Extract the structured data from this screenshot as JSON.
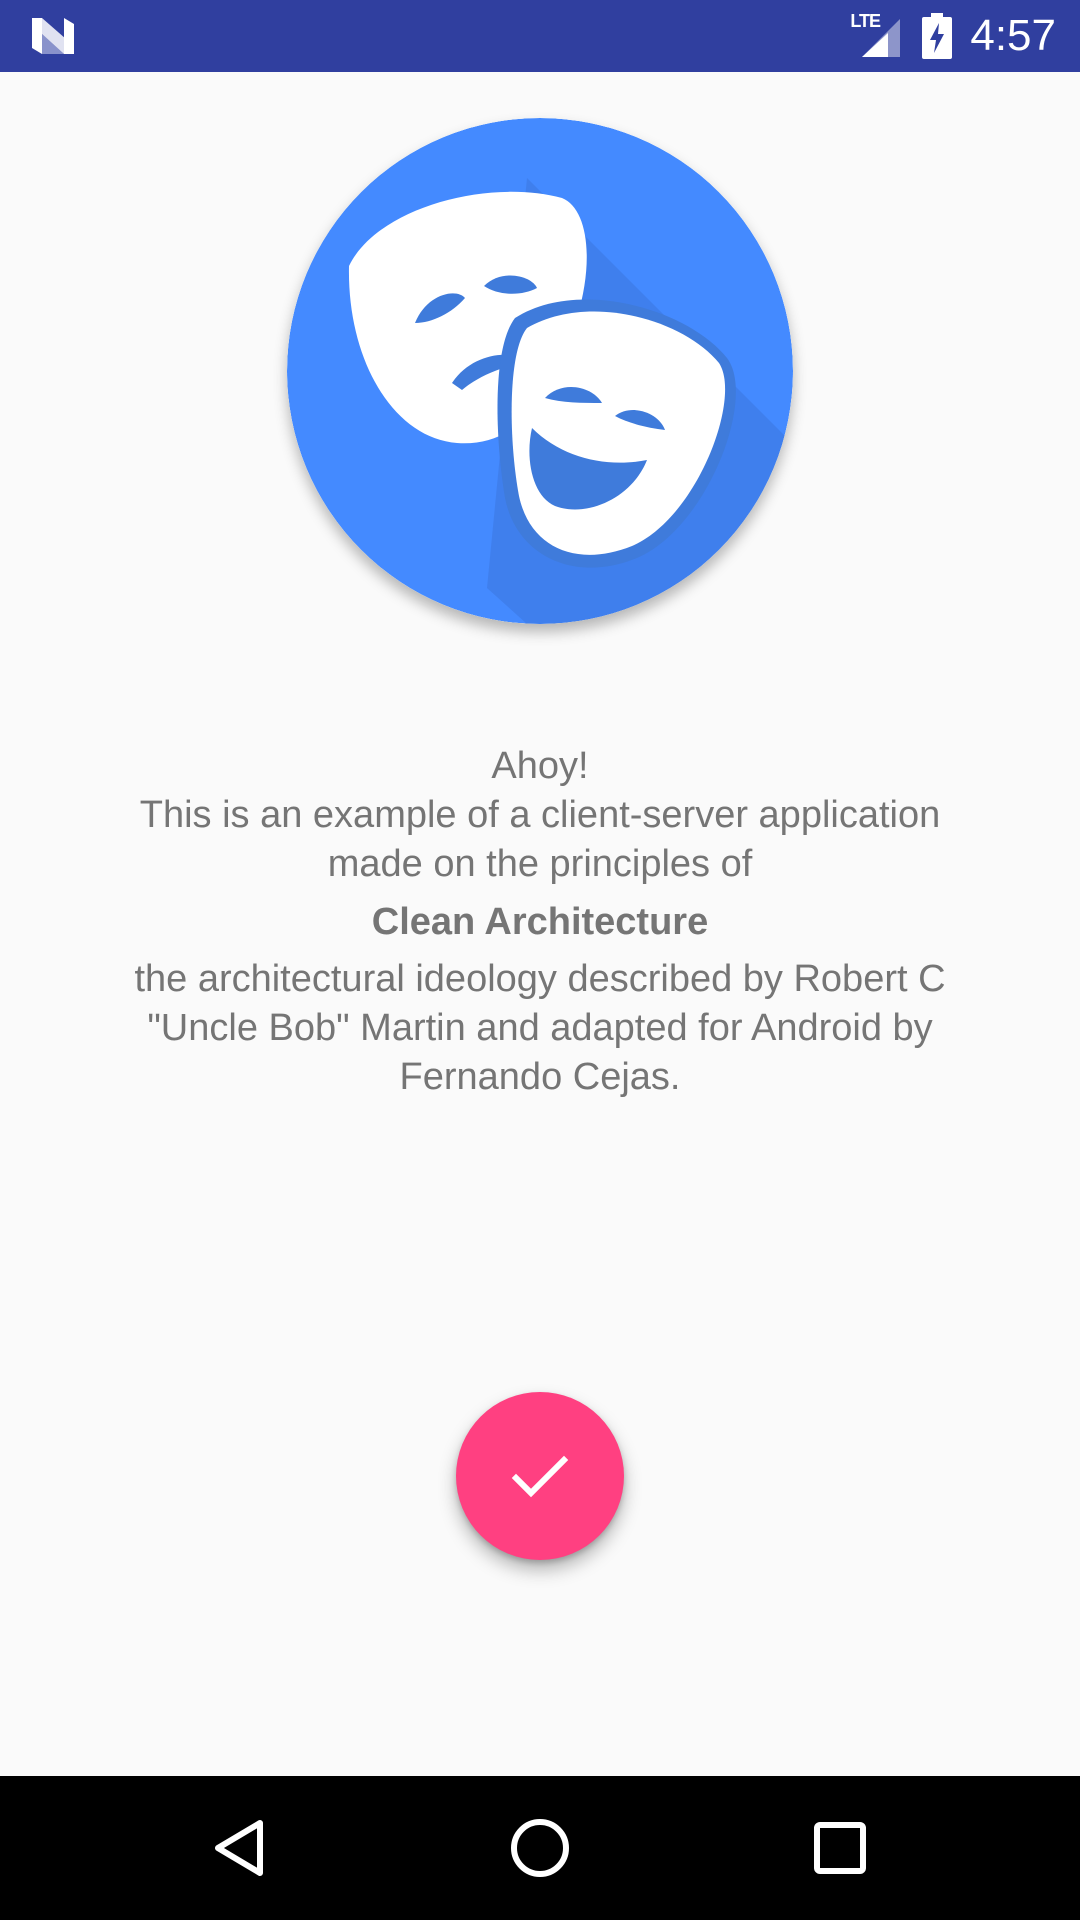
{
  "status_bar": {
    "time": "4:57",
    "network_label": "LTE",
    "icons": [
      "n-logo-icon",
      "lte-signal-icon",
      "battery-charging-icon"
    ],
    "background_color": "#303F9F"
  },
  "logo": {
    "icon": "theater-masks-icon",
    "background_color": "#448AFF"
  },
  "intro": {
    "greeting": "Ahoy!",
    "line1": "This is an example of a client-server application",
    "line2": "made on the principles of",
    "title": "Clean Architecture",
    "line3": "the architectural ideology described by Robert C",
    "line4": "\"Uncle Bob\" Martin and adapted for Android by",
    "line5": "Fernando Cejas."
  },
  "fab": {
    "icon": "check-icon",
    "color": "#FF4081"
  },
  "nav_bar": {
    "buttons": [
      "back-icon",
      "home-icon",
      "recents-icon"
    ]
  }
}
